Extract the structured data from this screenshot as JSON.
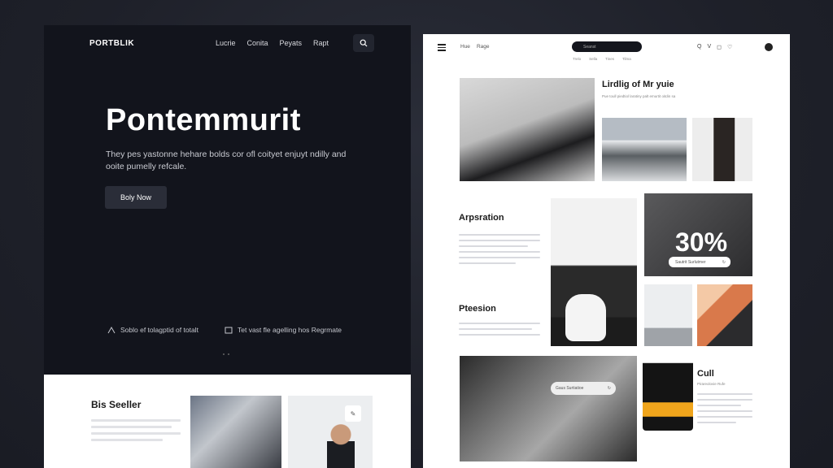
{
  "left": {
    "brand": "PORTBLIK",
    "nav": [
      "Lucrie",
      "Conita",
      "Peyats",
      "Rapt"
    ],
    "hero": {
      "title": "Pontemmurit",
      "subtitle": "They pes yastonne hehare bolds cor ofl coityet enjuyt ndilly and ooite pumelly refcale.",
      "button": "Boly Now"
    },
    "features": [
      "Soblo ef tolagptid of totalt",
      "Tet vast fle agelling hos Regrmate"
    ],
    "bottom": {
      "title": "Bis Seeller"
    }
  },
  "right": {
    "nav": [
      "Hue",
      "Rage"
    ],
    "search_placeholder": "Seanst",
    "sublinks": [
      "Trelo",
      "Sella",
      "Tines",
      "Tilma"
    ],
    "icons": [
      "Q",
      "V",
      "◻",
      "♡"
    ],
    "heading1": "Lirdlig of Mr yuie",
    "heading1_sub": "Pue toull piedtiol laratiny palt emurtit oitdin sa",
    "heading2": "Arpsration",
    "heading3": "Pteesion",
    "promo": {
      "value": "30%",
      "pill_text": "Sautrit Surlutmer"
    },
    "gshoe_pill": "Gaus Surtiatioe",
    "heading4": "Cull",
    "heading4_sub": "Pirareolovie Rufe"
  }
}
